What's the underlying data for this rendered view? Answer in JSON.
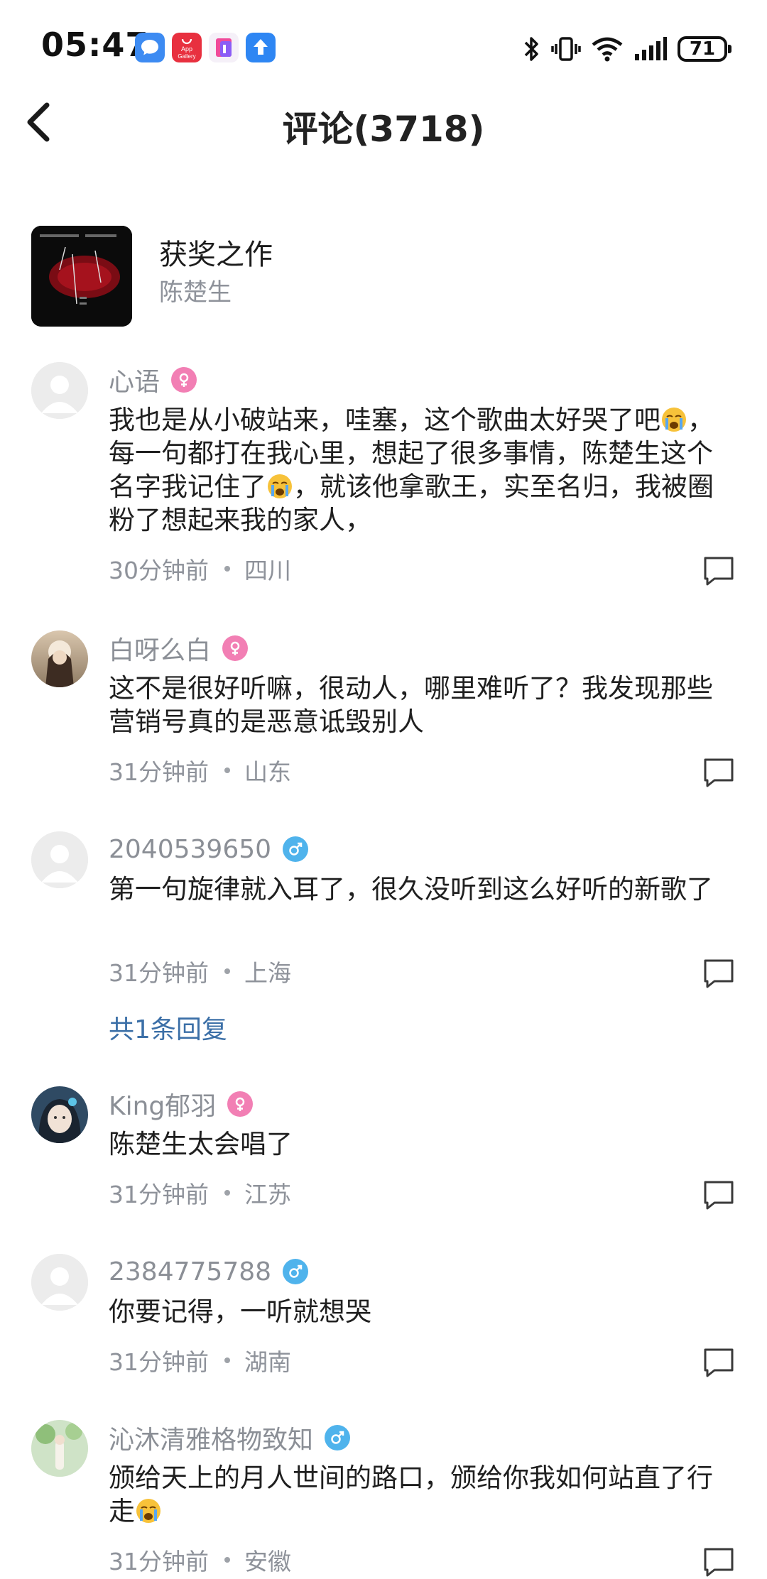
{
  "status_bar": {
    "time": "05:47",
    "battery": "71",
    "app_icons": [
      "message-app-icon",
      "app-gallery-icon",
      "gallery-app-icon",
      "update-app-icon"
    ],
    "app_gallery_label_1": "App",
    "app_gallery_label_2": "Gallery"
  },
  "header": {
    "title": "评论(3718)"
  },
  "song": {
    "title": "获奖之作",
    "artist": "陈楚生"
  },
  "colors": {
    "female_badge": "#f27fb4",
    "male_badge": "#4fb3ec",
    "reply_link": "#3b6fa7",
    "meta_text": "#8e929a"
  },
  "comments": [
    {
      "username": "心语",
      "gender": "female",
      "text_parts": [
        "我也是从小破站来，哇塞，这个歌曲太好哭了吧",
        "，每一句都打在我心里，想起了很多事情，陈楚生这个名字我记住了",
        "，就该他拿歌王，实至名归，我被圈粉了想起来我的家人，"
      ],
      "time": "30分钟前",
      "location": "四川"
    },
    {
      "username": "白呀么白",
      "gender": "female",
      "text": "这不是很好听嘛，很动人，哪里难听了？我发现那些营销号真的是恶意诋毁别人",
      "time": "31分钟前",
      "location": "山东"
    },
    {
      "username": "2040539650",
      "gender": "male",
      "text": "第一句旋律就入耳了，很久没听到这么好听的新歌了",
      "time": "31分钟前",
      "location": "上海",
      "reply_count": "共1条回复"
    },
    {
      "username": "King郁羽",
      "gender": "female",
      "text": "陈楚生太会唱了",
      "time": "31分钟前",
      "location": "江苏"
    },
    {
      "username": "2384775788",
      "gender": "male",
      "text": "你要记得，一听就想哭",
      "time": "31分钟前",
      "location": "湖南"
    },
    {
      "username": "沁沐清雅格物致知",
      "gender": "male",
      "text": "颁给天上的月人世间的路口，颁给你我如何站直了行走",
      "time": "31分钟前",
      "location": "安徽"
    }
  ]
}
